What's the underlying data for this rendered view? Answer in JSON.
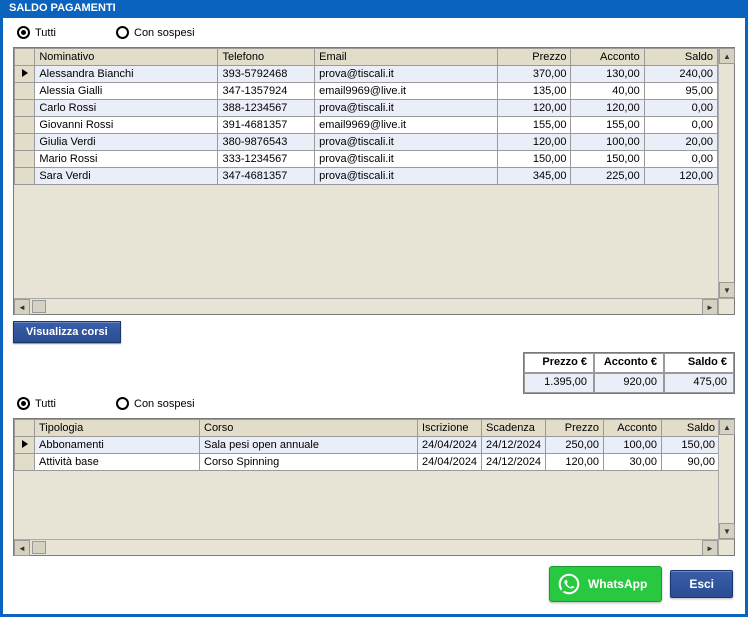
{
  "window": {
    "title": "SALDO PAGAMENTI"
  },
  "radios_top": {
    "all": "Tutti",
    "suspended": "Con sospesi",
    "selected": "all"
  },
  "grid1": {
    "headers": {
      "nominativo": "Nominativo",
      "telefono": "Telefono",
      "email": "Email",
      "prezzo": "Prezzo",
      "acconto": "Acconto",
      "saldo": "Saldo"
    },
    "selected_row": 0,
    "rows": [
      {
        "nominativo": "Alessandra Bianchi",
        "telefono": "393-5792468",
        "email": "prova@tiscali.it",
        "prezzo": "370,00",
        "acconto": "130,00",
        "saldo": "240,00"
      },
      {
        "nominativo": "Alessia Gialli",
        "telefono": "347-1357924",
        "email": "email9969@live.it",
        "prezzo": "135,00",
        "acconto": "40,00",
        "saldo": "95,00"
      },
      {
        "nominativo": "Carlo Rossi",
        "telefono": "388-1234567",
        "email": "prova@tiscali.it",
        "prezzo": "120,00",
        "acconto": "120,00",
        "saldo": "0,00"
      },
      {
        "nominativo": "Giovanni Rossi",
        "telefono": "391-4681357",
        "email": "email9969@live.it",
        "prezzo": "155,00",
        "acconto": "155,00",
        "saldo": "0,00"
      },
      {
        "nominativo": "Giulia Verdi",
        "telefono": "380-9876543",
        "email": "prova@tiscali.it",
        "prezzo": "120,00",
        "acconto": "100,00",
        "saldo": "20,00"
      },
      {
        "nominativo": "Mario Rossi",
        "telefono": "333-1234567",
        "email": "prova@tiscali.it",
        "prezzo": "150,00",
        "acconto": "150,00",
        "saldo": "0,00"
      },
      {
        "nominativo": "Sara Verdi",
        "telefono": "347-4681357",
        "email": "prova@tiscali.it",
        "prezzo": "345,00",
        "acconto": "225,00",
        "saldo": "120,00"
      }
    ]
  },
  "buttons": {
    "visualizza_corsi": "Visualizza corsi",
    "whatsapp": "WhatsApp",
    "esci": "Esci"
  },
  "totals": {
    "headers": {
      "prezzo": "Prezzo €",
      "acconto": "Acconto €",
      "saldo": "Saldo €"
    },
    "values": {
      "prezzo": "1.395,00",
      "acconto": "920,00",
      "saldo": "475,00"
    }
  },
  "radios_bottom": {
    "all": "Tutti",
    "suspended": "Con sospesi",
    "selected": "all"
  },
  "grid2": {
    "headers": {
      "tipologia": "Tipologia",
      "corso": "Corso",
      "iscrizione": "Iscrizione",
      "scadenza": "Scadenza",
      "prezzo": "Prezzo",
      "acconto": "Acconto",
      "saldo": "Saldo"
    },
    "selected_row": 0,
    "rows": [
      {
        "tipologia": "Abbonamenti",
        "corso": "Sala pesi open annuale",
        "iscrizione": "24/04/2024",
        "scadenza": "24/12/2024",
        "prezzo": "250,00",
        "acconto": "100,00",
        "saldo": "150,00"
      },
      {
        "tipologia": "Attività base",
        "corso": "Corso Spinning",
        "iscrizione": "24/04/2024",
        "scadenza": "24/12/2024",
        "prezzo": "120,00",
        "acconto": "30,00",
        "saldo": "90,00"
      }
    ]
  }
}
